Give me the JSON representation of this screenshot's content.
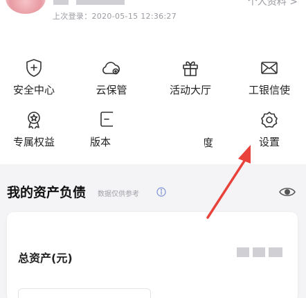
{
  "header": {
    "last_login_label": "上次登录：",
    "last_login_time": "2020-05-15 12:36:27",
    "profile_link": "个人资料 >"
  },
  "menu": {
    "security_center": "安全中心",
    "cloud_custody": "云保管",
    "events_hall": "活动大厅",
    "icbc_messenger": "工银信使",
    "exclusive_benefits": "专属权益",
    "version_partial": "版本",
    "partial_right": "度",
    "settings": "设置"
  },
  "assets": {
    "title": "我的资产负债",
    "note": "数据仅供参考",
    "total_label": "总资产(元)"
  },
  "colors": {
    "arrow": "#e8423b",
    "accent": "#222222"
  }
}
